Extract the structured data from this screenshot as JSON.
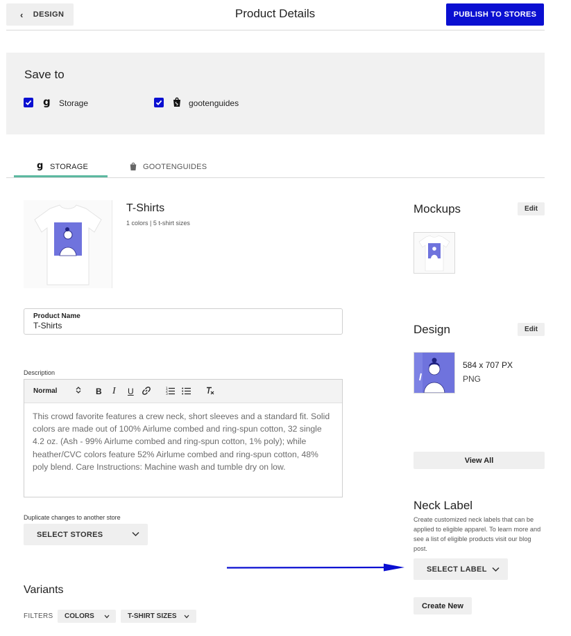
{
  "header": {
    "back_label": "DESIGN",
    "title": "Product Details",
    "publish_label": "PUBLISH TO STORES"
  },
  "save_to": {
    "title": "Save to",
    "stores": [
      {
        "label": "Storage",
        "checked": true,
        "icon": "gooten-g-icon"
      },
      {
        "label": "gootenguides",
        "checked": true,
        "icon": "shopify-bag-icon"
      }
    ]
  },
  "tabs": [
    {
      "label": "STORAGE",
      "active": true,
      "icon": "gooten-g-icon"
    },
    {
      "label": "GOOTENGUIDES",
      "active": false,
      "icon": "shopify-bag-icon"
    }
  ],
  "product": {
    "title": "T-Shirts",
    "subtitle": "1 colors | 5 t-shirt sizes",
    "name_label": "Product Name",
    "name_value": "T-Shirts",
    "description_label": "Description",
    "editor_format": "Normal",
    "description": "This crowd favorite features a crew neck, short sleeves and a standard fit. Solid colors are made out of 100% Airlume combed and ring-spun cotton, 32 single 4.2 oz. (Ash - 99% Airlume combed and ring-spun cotton, 1% poly); while heather/CVC colors feature 52% Airlume combed and ring-spun cotton, 48% poly blend. Care Instructions: Machine wash and tumble dry on low."
  },
  "duplicate": {
    "label": "Duplicate changes to another store",
    "select_label": "SELECT STORES"
  },
  "variants": {
    "title": "Variants",
    "filters_label": "FILTERS",
    "chips": [
      "COLORS",
      "T-SHIRT SIZES"
    ]
  },
  "mockups": {
    "title": "Mockups",
    "edit_label": "Edit"
  },
  "design": {
    "title": "Design",
    "edit_label": "Edit",
    "dimensions": "584 x 707 PX",
    "format": "PNG",
    "view_all_label": "View All"
  },
  "neck_label": {
    "title": "Neck Label",
    "description": "Create customized neck labels that can be applied to eligible apparel. To learn more and see a list of eligible products visit our blog post.",
    "select_label": "SELECT LABEL",
    "create_label": "Create New"
  },
  "colors": {
    "primary": "#0a0fd1",
    "tab_accent": "#5cb8a0",
    "design_purple": "#6f73dd"
  }
}
